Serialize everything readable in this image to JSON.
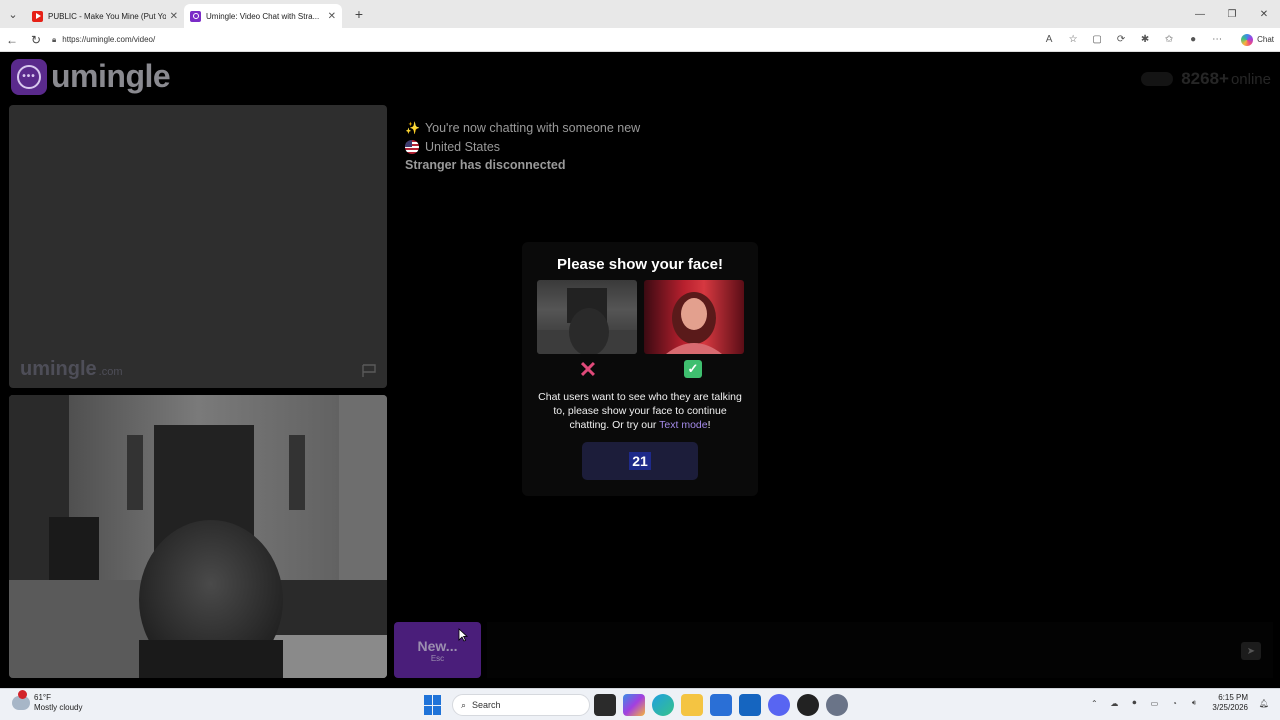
{
  "browser": {
    "tabs": [
      {
        "title": "PUBLIC - Make You Mine (Put Your...",
        "favicon_color": "#e62117",
        "active": false
      },
      {
        "title": "Umingle: Video Chat with Stra...",
        "favicon_color": "#7b2cc7",
        "active": true
      }
    ],
    "url": "https://umingle.com/video/",
    "copilot_label": "Chat"
  },
  "site": {
    "logo_text": "umingle",
    "online_count": "8268+",
    "online_label": "online",
    "brand_watermark": "umingle",
    "brand_watermark_suffix": ".com"
  },
  "chat": {
    "messages": [
      {
        "icon": "sparkles-icon",
        "text": "You're now chatting with someone new"
      },
      {
        "icon": "us-flag-icon",
        "text": "United States"
      },
      {
        "icon": null,
        "text": "Stranger has disconnected"
      }
    ]
  },
  "modal": {
    "title": "Please show your face!",
    "body_text": "Chat users want to see who they are talking to, please show your face to continue chatting. Or try our ",
    "link_text": "Text mode",
    "body_suffix": "!",
    "countdown": "21"
  },
  "controls": {
    "new_label": "New...",
    "new_hint": "Esc"
  },
  "taskbar": {
    "temperature": "61°F",
    "weather": "Mostly cloudy",
    "search_placeholder": "Search",
    "time": "6:15 PM",
    "date": "3/25/2026"
  }
}
